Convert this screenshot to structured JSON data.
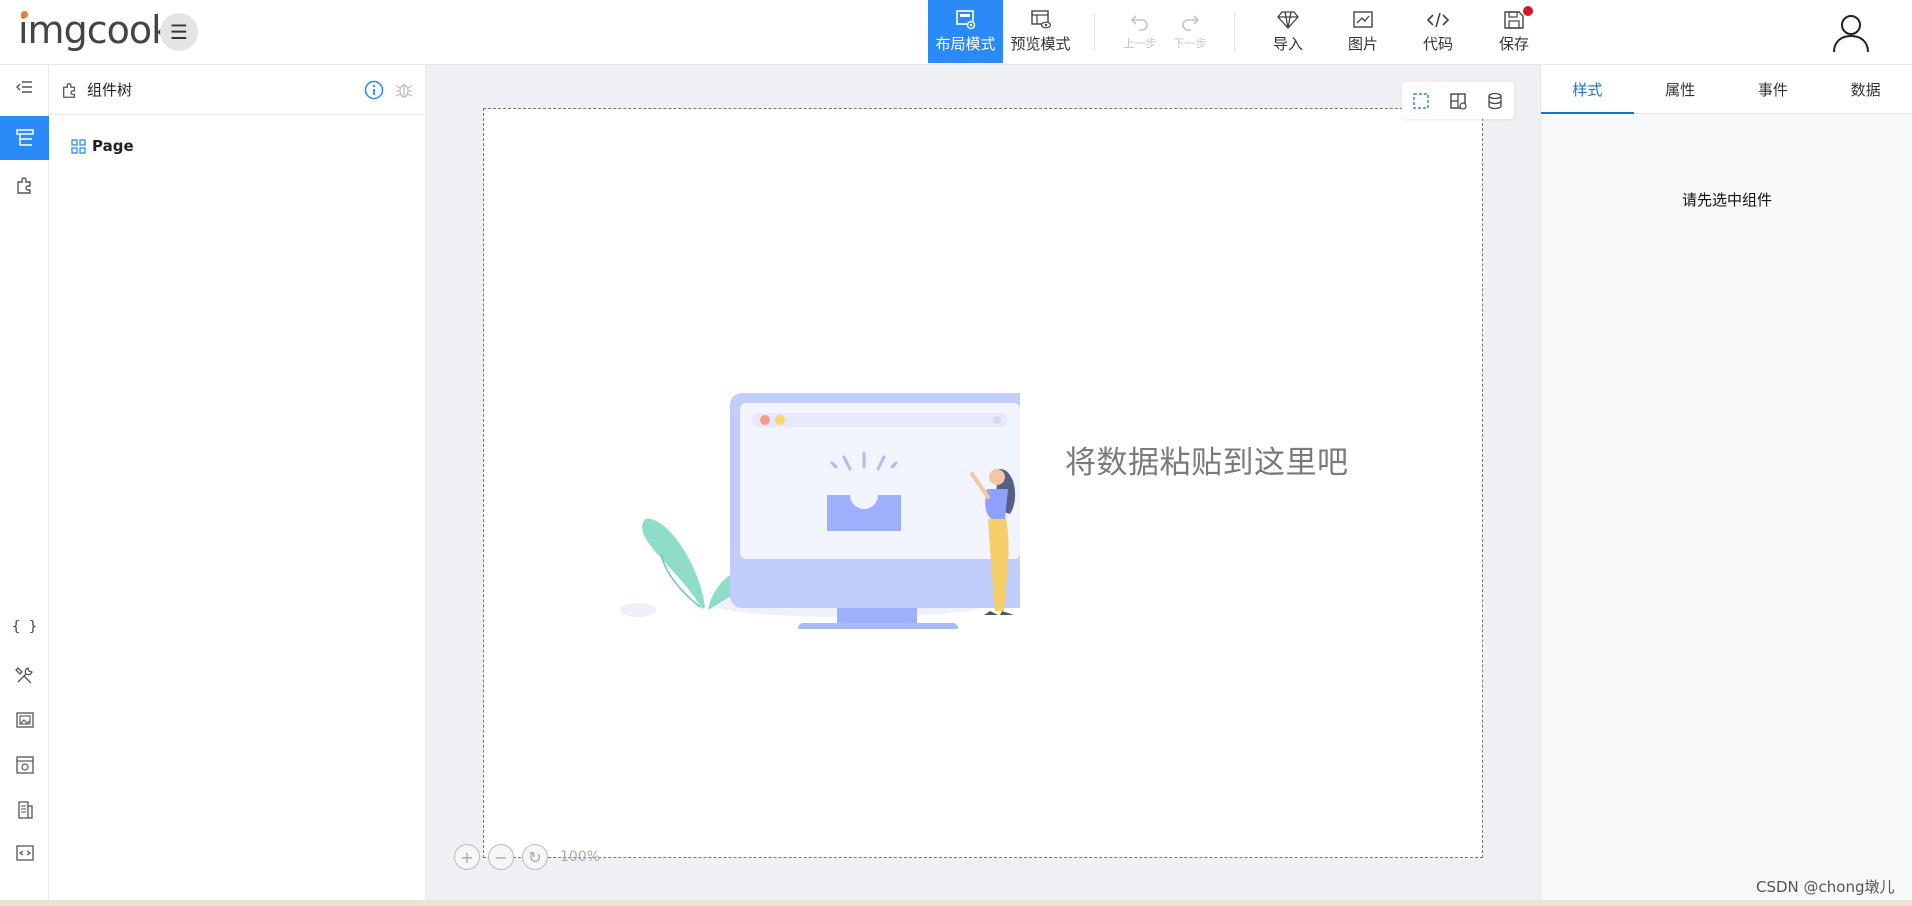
{
  "app": {
    "logo": "imgcook"
  },
  "toolbar": {
    "layout_mode": "布局模式",
    "preview_mode": "预览模式",
    "undo": "上一步",
    "redo": "下一步",
    "import": "导入",
    "image": "图片",
    "code": "代码",
    "save": "保存"
  },
  "tree_panel": {
    "title": "组件树",
    "root_node": "Page"
  },
  "canvas": {
    "empty_text": "将数据粘贴到这里吧",
    "zoom": "100%"
  },
  "props_panel": {
    "tabs": [
      "样式",
      "属性",
      "事件",
      "数据"
    ],
    "active_tab": "样式",
    "hint": "请先选中组件"
  },
  "watermark": "CSDN @chong墩儿",
  "colors": {
    "accent": "#2a8af7",
    "tab_active": "#1a6fd9",
    "canvas_bg": "#eef0f3",
    "save_badge": "#d1162a"
  }
}
